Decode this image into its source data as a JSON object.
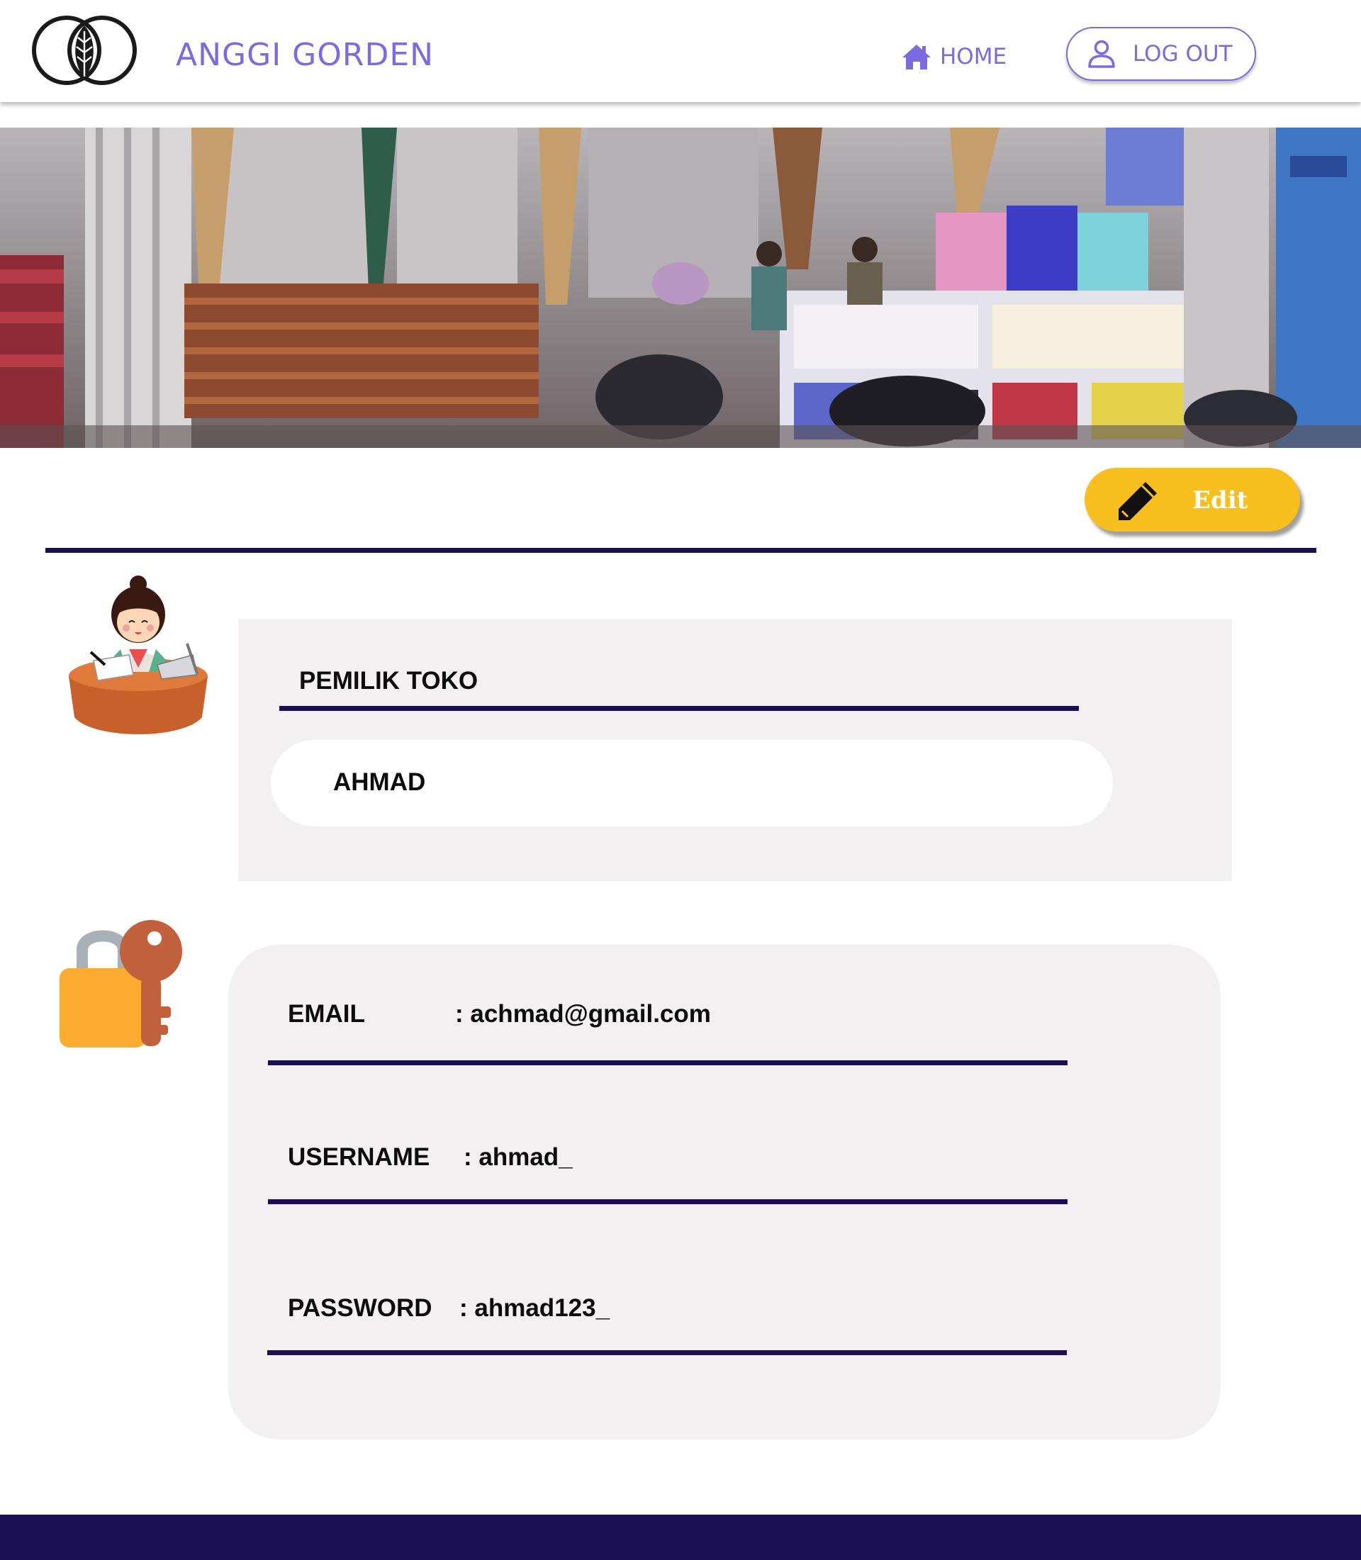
{
  "header": {
    "brand": "ANGGI GORDEN",
    "home_label": "HOME",
    "logout_label": "LOG OUT",
    "accent_color": "#7b6be0",
    "logo_icon": "leaf-rings-logo"
  },
  "banner": {
    "image": "curtain-shop-storefront-photo"
  },
  "toolbar": {
    "edit_label": "Edit",
    "edit_icon": "pencil-icon",
    "edit_color": "#f9bf1e"
  },
  "owner": {
    "title": "PEMILIK TOKO",
    "name": "AHMAD",
    "avatar_icon": "shop-owner-avatar"
  },
  "account": {
    "icon": "lock-key-icon",
    "fields": [
      {
        "label": "EMAIL",
        "value": ": achmad@gmail.com"
      },
      {
        "label": "USERNAME",
        "value": ": ahmad_"
      },
      {
        "label": "PASSWORD",
        "value": ": ahmad123_"
      }
    ]
  },
  "theme": {
    "navy": "#1a0f52",
    "card_bg": "#f2f0f1"
  }
}
